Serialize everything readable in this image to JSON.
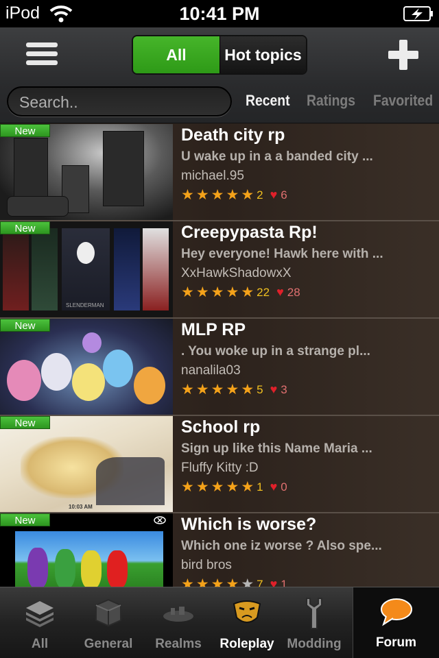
{
  "status_bar": {
    "carrier": "iPod",
    "time": "10:41 PM"
  },
  "nav": {
    "segments": {
      "all": "All",
      "hot": "Hot topics"
    },
    "search_placeholder": "Search..",
    "sort_tabs": [
      "Recent",
      "Ratings",
      "Favorited"
    ],
    "active_sort": "Recent"
  },
  "badge_label": "New",
  "threads": [
    {
      "title": "Death city rp",
      "snippet": "U wake up in a a banded city ...",
      "author": "michael.95",
      "stars": 5,
      "rating_count": "2",
      "hearts": "6"
    },
    {
      "title": "Creepypasta Rp!",
      "snippet": "Hey everyone! Hawk here with ...",
      "author": "XxHawkShadowxX",
      "stars": 5,
      "rating_count": "22",
      "hearts": "28",
      "thumb_text": "SLENDERMAN"
    },
    {
      "title": "MLP RP",
      "snippet": ". You woke up in a strange pl...",
      "author": "nanalila03",
      "stars": 5,
      "rating_count": "5",
      "hearts": "3"
    },
    {
      "title": "School rp",
      "snippet": "Sign up like this Name Maria ...",
      "author": "Fluffy Kitty :D",
      "stars": 5,
      "rating_count": "1",
      "hearts": "0",
      "thumb_text": "10:03 AM"
    },
    {
      "title": "Which is worse?",
      "snippet": "Which one iz worse ? Also spe...",
      "author": "bird bros",
      "stars": 4,
      "rating_count": "7",
      "hearts": "1"
    }
  ],
  "tabbar": {
    "tabs": [
      "All",
      "General",
      "Realms",
      "Roleplay",
      "Modding"
    ],
    "active": "Roleplay",
    "forum": "Forum"
  },
  "colors": {
    "accent_green": "#3aa822",
    "star": "#f4a21a",
    "heart": "#e0202a"
  }
}
